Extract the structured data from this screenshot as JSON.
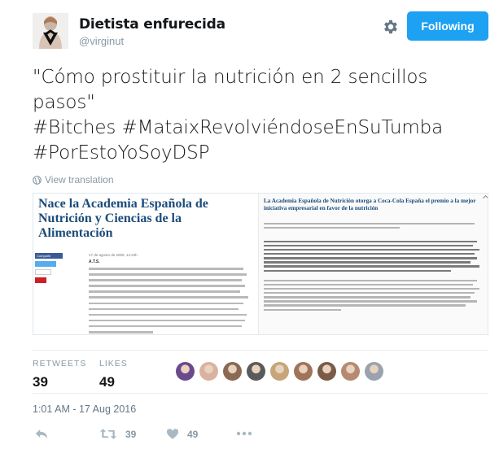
{
  "user": {
    "display_name": "Dietista enfurecida",
    "handle": "@virginut",
    "follow_label": "Following"
  },
  "tweet": {
    "lines": [
      "\"Cómo prostituir la nutrición en 2 sencillos",
      "pasos\"",
      "#Bitches #MataixRevolviéndoseEnSuTumba",
      "#PorEstoYoSoyDSP"
    ],
    "translate_label": "View translation"
  },
  "media": {
    "left_article": {
      "title": "Nace la Academia Española de Nutrición y Ciencias de la Alimentación",
      "date": "17 de agosto de 2009, 14:24h",
      "byline": "A.T.S.",
      "share_label": "Compartir"
    },
    "right_article": {
      "title": "La Academia Española de Nutrición otorga a Coca-Cola España el premio a la mejor iniciativa empresarial en favor de la nutrición"
    }
  },
  "stats": {
    "retweets_label": "RETWEETS",
    "retweets_value": "39",
    "likes_label": "LIKES",
    "likes_value": "49",
    "liker_colors": [
      "#6b4a8c",
      "#d9b3a0",
      "#8a6a52",
      "#5a5a5a",
      "#c7a57a",
      "#a0745a",
      "#7b5a48",
      "#b58a70",
      "#9aa3ad"
    ]
  },
  "timestamp": "1:01 AM - 17 Aug 2016",
  "actions": {
    "retweet_count": "39",
    "like_count": "49"
  },
  "colors": {
    "accent": "#1da1f2",
    "muted": "#8899a6",
    "text": "#14171a"
  }
}
